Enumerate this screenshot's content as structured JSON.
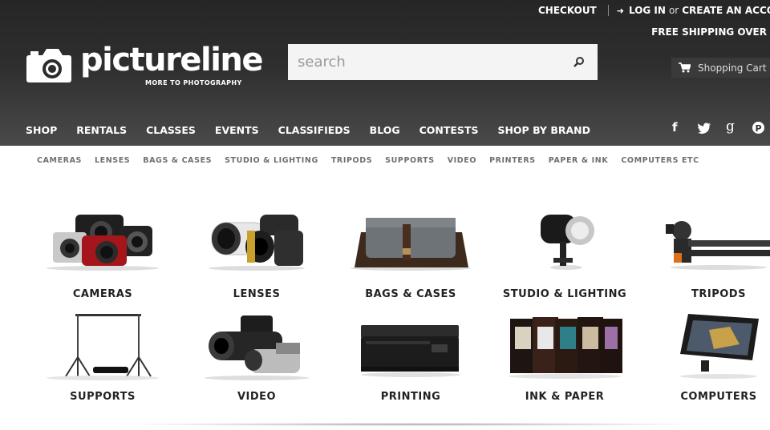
{
  "header": {
    "checkout": "CHECKOUT",
    "login": "LOG IN",
    "or": "or",
    "create_account": "CREATE AN ACCO",
    "free_shipping": "FREE SHIPPING OVER",
    "logo_word": "pictureline",
    "logo_tagline": "MORE TO PHOTOGRAPHY",
    "search_placeholder": "search",
    "cart_label": "Shopping Cart"
  },
  "main_nav": [
    "SHOP",
    "RENTALS",
    "CLASSES",
    "EVENTS",
    "CLASSIFIEDS",
    "BLOG",
    "CONTESTS",
    "SHOP BY BRAND"
  ],
  "social": [
    {
      "icon": "facebook-icon",
      "glyph": "f"
    },
    {
      "icon": "twitter-icon",
      "glyph": "t"
    },
    {
      "icon": "google-plus-icon",
      "glyph": "g"
    },
    {
      "icon": "pinterest-icon",
      "glyph": "p"
    }
  ],
  "sub_nav": [
    "CAMERAS",
    "LENSES",
    "BAGS & CASES",
    "STUDIO & LIGHTING",
    "TRIPODS",
    "SUPPORTS",
    "VIDEO",
    "PRINTERS",
    "PAPER & INK",
    "COMPUTERS ETC"
  ],
  "categories_row1": [
    "CAMERAS",
    "LENSES",
    "BAGS & CASES",
    "STUDIO & LIGHTING",
    "TRIPODS"
  ],
  "categories_row2": [
    "SUPPORTS",
    "VIDEO",
    "PRINTING",
    "INK & PAPER",
    "COMPUTERS"
  ],
  "colors": {
    "header_dark": "#2a2a2a",
    "text_white": "#ffffff",
    "subnav_gray": "#6f6f6f"
  }
}
